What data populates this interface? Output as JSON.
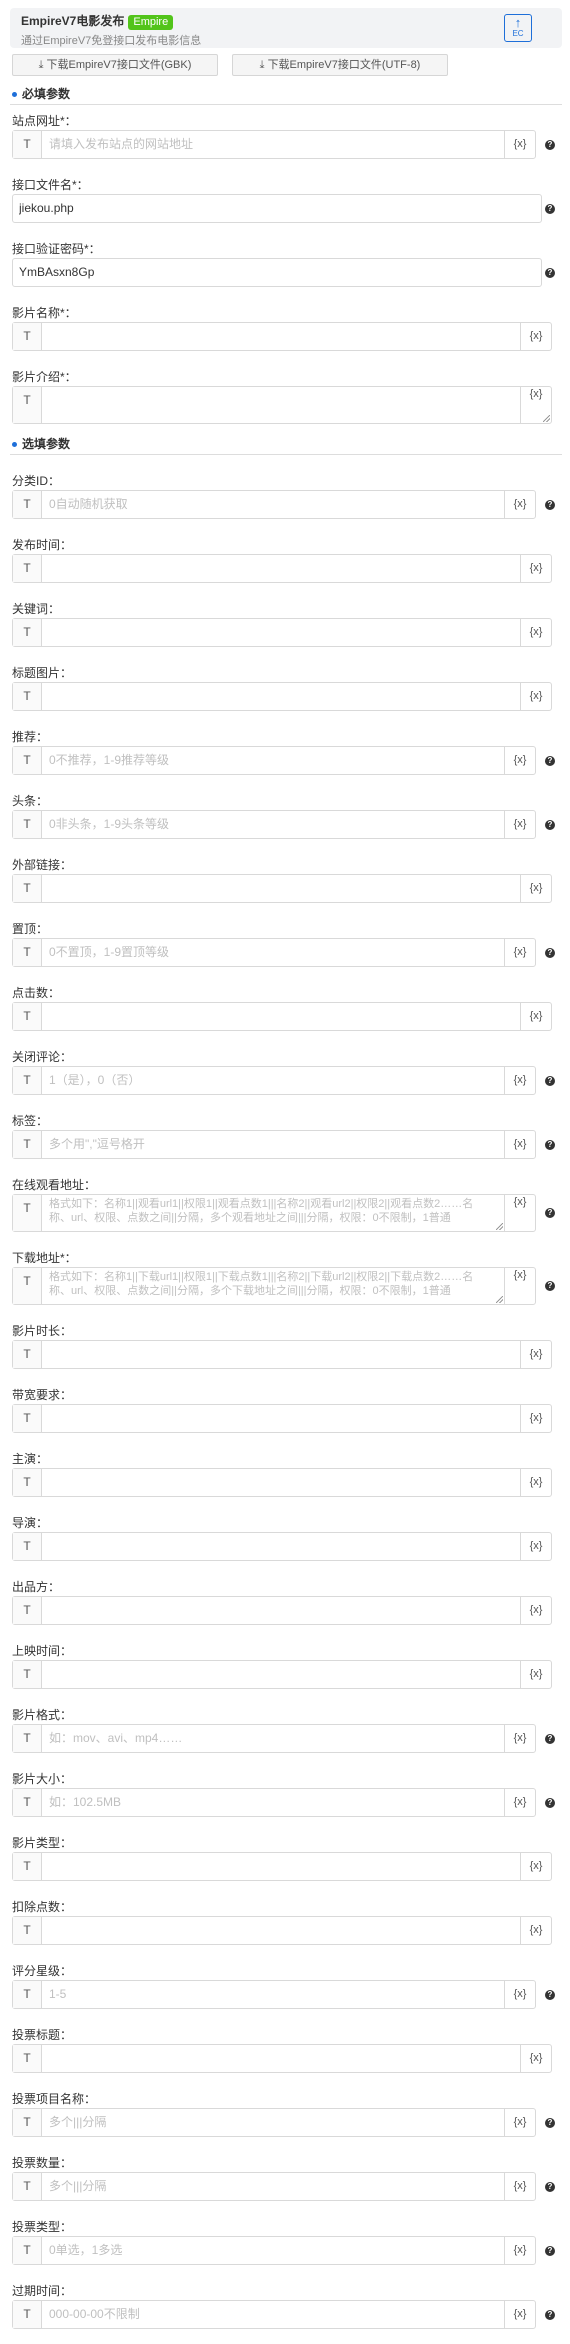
{
  "header": {
    "title": "EmpireV7电影发布",
    "badge": "Empire",
    "subtitle": "通过EmpireV7免登接口发布电影信息",
    "logo_text": "EC",
    "logo_icon": "upload-arrow-icon"
  },
  "downloads": {
    "gbk": "下载EmpireV7接口文件(GBK)",
    "utf8": "下载EmpireV7接口文件(UTF-8)",
    "icon": "download-icon"
  },
  "sections": {
    "required": "必填参数",
    "optional": "选填参数"
  },
  "common": {
    "prefix": "T",
    "var_button": "{x}",
    "help": "?"
  },
  "required_fields": [
    {
      "id": "site-url",
      "label": "站点网址*：",
      "placeholder": "请填入发布站点的网站地址",
      "value": "",
      "help": true
    },
    {
      "id": "api-file",
      "label": "接口文件名*：",
      "placeholder": "",
      "value": "jiekou.php",
      "help": true,
      "plain": true
    },
    {
      "id": "api-password",
      "label": "接口验证密码*：",
      "placeholder": "",
      "value": "YmBAsxn8Gp",
      "help": true,
      "plain": true
    },
    {
      "id": "movie-name",
      "label": "影片名称*：",
      "placeholder": "",
      "value": "",
      "help": false
    },
    {
      "id": "movie-intro",
      "label": "影片介绍*：",
      "placeholder": "",
      "value": "",
      "help": false,
      "textarea": true
    }
  ],
  "optional_fields": [
    {
      "id": "category-id",
      "label": "分类ID：",
      "placeholder": "0自动随机获取",
      "help": true
    },
    {
      "id": "publish-time",
      "label": "发布时间：",
      "placeholder": "",
      "help": false
    },
    {
      "id": "keywords",
      "label": "关键词：",
      "placeholder": "",
      "help": false
    },
    {
      "id": "title-image",
      "label": "标题图片：",
      "placeholder": "",
      "help": false
    },
    {
      "id": "recommend",
      "label": "推荐：",
      "placeholder": "0不推荐，1-9推荐等级",
      "help": true
    },
    {
      "id": "headline",
      "label": "头条：",
      "placeholder": "0非头条，1-9头条等级",
      "help": true
    },
    {
      "id": "external-link",
      "label": "外部链接：",
      "placeholder": "",
      "help": false
    },
    {
      "id": "top",
      "label": "置顶：",
      "placeholder": "0不置顶，1-9置顶等级",
      "help": true
    },
    {
      "id": "clicks",
      "label": "点击数：",
      "placeholder": "",
      "help": false
    },
    {
      "id": "close-comment",
      "label": "关闭评论：",
      "placeholder": "1（是），0（否）",
      "help": true
    },
    {
      "id": "tags",
      "label": "标签：",
      "placeholder": "多个用\",\"逗号格开",
      "help": true
    },
    {
      "id": "online-watch",
      "label": "在线观看地址：",
      "placeholder": "格式如下：名称1||观看url1||权限1||观看点数1|||名称2||观看url2||权限2||观看点数2……名称、url、权限、点数之间||分隔，多个观看地址之间|||分隔，权限：0不限制，1普通",
      "help": true,
      "textarea": true
    },
    {
      "id": "download-url",
      "label": "下载地址*：",
      "placeholder": "格式如下：名称1||下载url1||权限1||下载点数1|||名称2||下载url2||权限2||下载点数2……名称、url、权限、点数之间||分隔，多个下载地址之间|||分隔，权限：0不限制，1普通",
      "help": true,
      "textarea": true
    },
    {
      "id": "duration",
      "label": "影片时长：",
      "placeholder": "",
      "help": false
    },
    {
      "id": "bandwidth",
      "label": "带宽要求：",
      "placeholder": "",
      "help": false
    },
    {
      "id": "starring",
      "label": "主演：",
      "placeholder": "",
      "help": false
    },
    {
      "id": "director",
      "label": "导演：",
      "placeholder": "",
      "help": false
    },
    {
      "id": "producer",
      "label": "出品方：",
      "placeholder": "",
      "help": false
    },
    {
      "id": "release-time",
      "label": "上映时间：",
      "placeholder": "",
      "help": false
    },
    {
      "id": "format",
      "label": "影片格式：",
      "placeholder": "如：mov、avi、mp4……",
      "help": true
    },
    {
      "id": "size",
      "label": "影片大小：",
      "placeholder": "如：102.5MB",
      "help": true
    },
    {
      "id": "movie-type",
      "label": "影片类型：",
      "placeholder": "",
      "help": false
    },
    {
      "id": "deduct-points",
      "label": "扣除点数：",
      "placeholder": "",
      "help": false
    },
    {
      "id": "rating",
      "label": "评分星级：",
      "placeholder": "1-5",
      "help": true
    },
    {
      "id": "vote-title",
      "label": "投票标题：",
      "placeholder": "",
      "help": false
    },
    {
      "id": "vote-items",
      "label": "投票项目名称：",
      "placeholder": "多个|||分隔",
      "help": true
    },
    {
      "id": "vote-count",
      "label": "投票数量：",
      "placeholder": "多个|||分隔",
      "help": true
    },
    {
      "id": "vote-type",
      "label": "投票类型：",
      "placeholder": "0单选，1多选",
      "help": true
    },
    {
      "id": "expire-time",
      "label": "过期时间：",
      "placeholder": "000-00-00不限制",
      "help": true
    }
  ]
}
